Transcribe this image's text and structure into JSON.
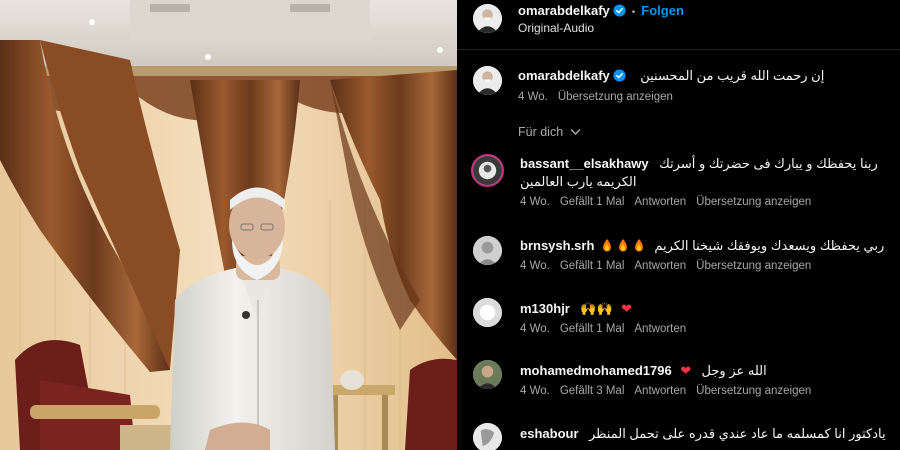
{
  "header": {
    "username": "omarabdelkafy",
    "follow_label": "Folgen",
    "audio_label": "Original-Audio"
  },
  "caption": {
    "username": "omarabdelkafy",
    "text": "إن رحمت الله قريب من المحسنين",
    "time": "4 Wo.",
    "translate_label": "Übersetzung anzeigen"
  },
  "filter": {
    "label": "Für dich"
  },
  "comments": [
    {
      "username": "bassant__elsakhawy",
      "text_line1": "ربنا يحفظك و يبارك فى حضرتك و أسرتك",
      "text_line2": "الكريمه يارب العالمين",
      "time": "4 Wo.",
      "likes": "Gefällt 1 Mal",
      "reply": "Antworten",
      "translate": "Übersetzung anzeigen"
    },
    {
      "username": "brnsysh.srh",
      "text_line1": "ربي يحفظك ويسعدك ويوفقك شيخنا الكريم",
      "time": "4 Wo.",
      "likes": "Gefällt 1 Mal",
      "reply": "Antworten",
      "translate": "Übersetzung anzeigen"
    },
    {
      "username": "m130hjr",
      "text_line1": "🙌🙌",
      "time": "4 Wo.",
      "likes": "Gefällt 1 Mal",
      "reply": "Antworten"
    },
    {
      "username": "mohamedmohamed1796",
      "text_line1": "الله عز وجل",
      "time": "4 Wo.",
      "likes": "Gefällt 3 Mal",
      "reply": "Antworten",
      "translate": "Übersetzung anzeigen"
    },
    {
      "username": "eshabour",
      "text_line1": "يادكتور انا كمسلمه ما عاد عندي قدره على تحمل المنظر"
    }
  ],
  "icons": {
    "verified": "verified-badge-icon",
    "chevron": "chevron-down-icon",
    "fire": "fire-emoji-icon",
    "heart": "red-heart-emoji-icon",
    "raised_hands": "raised-hands-emoji-icon"
  },
  "colors": {
    "accent": "#0095f6",
    "secondary_text": "#a8a8a8",
    "background": "#000000",
    "heart": "#ff3040"
  }
}
